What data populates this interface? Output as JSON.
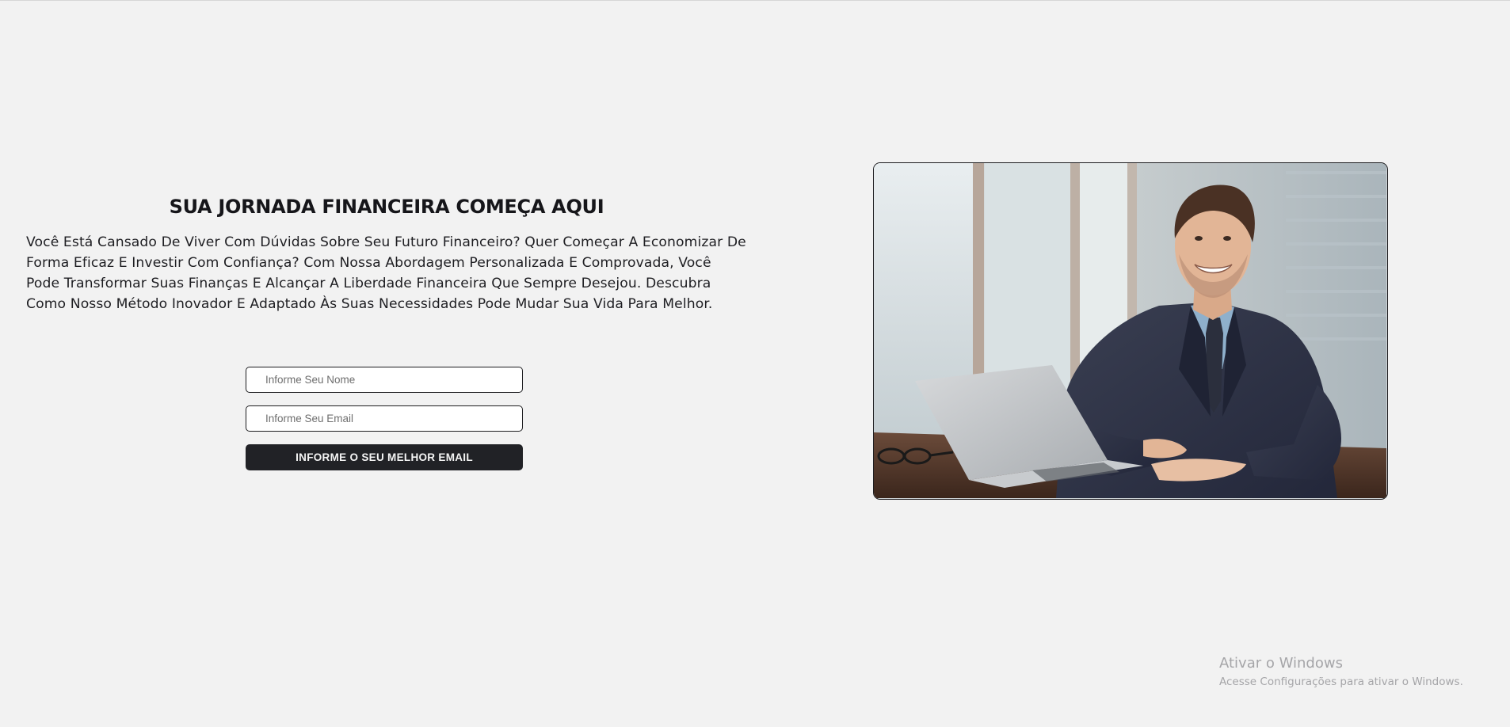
{
  "hero": {
    "title": "SUA JORNADA FINANCEIRA COMEÇA AQUI",
    "description": "Você Está Cansado De Viver Com Dúvidas Sobre Seu Futuro Financeiro? Quer Começar A Economizar De Forma Eficaz E Investir Com Confiança? Com Nossa Abordagem Personalizada E Comprovada, Você Pode Transformar Suas Finanças E Alcançar A Liberdade Financeira Que Sempre Desejou. Descubra Como Nosso Método Inovador E Adaptado Às Suas Necessidades Pode Mudar Sua Vida Para Melhor."
  },
  "form": {
    "name_placeholder": "Informe Seu Nome",
    "name_value": "",
    "email_placeholder": "Informe Seu Email",
    "email_value": "",
    "submit_label": "INFORME O SEU MELHOR EMAIL"
  },
  "image": {
    "subject": "smiling-businessman-at-desk-with-laptop"
  },
  "watermark": {
    "title": "Ativar o Windows",
    "subtitle": "Acesse Configurações para ativar o Windows."
  },
  "colors": {
    "background": "#f2f2f2",
    "button_bg": "#212226",
    "text": "#16161a",
    "border": "#1c1c1f"
  }
}
